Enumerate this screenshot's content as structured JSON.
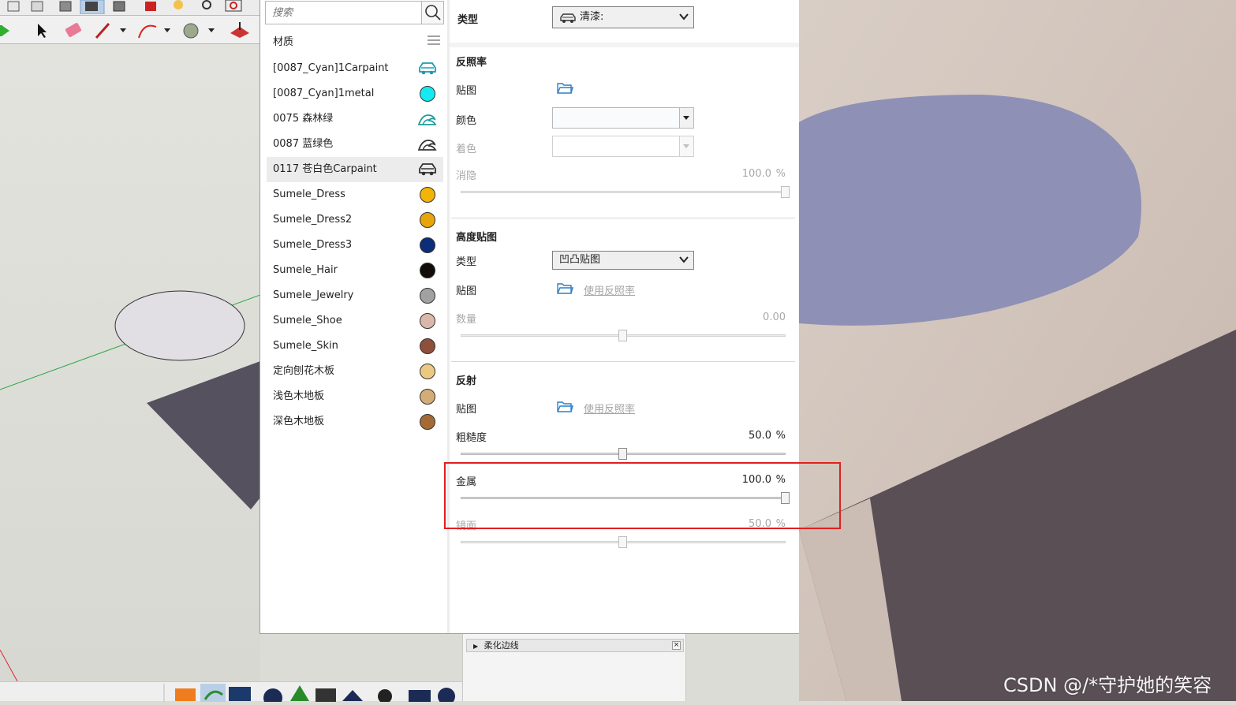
{
  "search": {
    "placeholder": "搜索"
  },
  "list_header": {
    "title": "材质"
  },
  "materials": [
    {
      "name": "[0087_Cyan]1Carpaint",
      "swatch": "car-icon",
      "color": "#1a9cb0"
    },
    {
      "name": "[0087_Cyan]1metal",
      "swatch": "circle",
      "color": "#15e9f2"
    },
    {
      "name": "0075 森林绿",
      "swatch": "wave-icon",
      "color": "#1a9c9c"
    },
    {
      "name": "0087 蓝绿色",
      "swatch": "wave-icon",
      "color": "#333333"
    },
    {
      "name": "0117 苍白色Carpaint",
      "swatch": "car-icon",
      "color": "#333333",
      "selected": true
    },
    {
      "name": "Sumele_Dress",
      "swatch": "circle",
      "color": "#f2b408"
    },
    {
      "name": "Sumele_Dress2",
      "swatch": "circle",
      "color": "#e8a40b"
    },
    {
      "name": "Sumele_Dress3",
      "swatch": "circle",
      "color": "#0b2d7a"
    },
    {
      "name": "Sumele_Hair",
      "swatch": "circle",
      "color": "#120c0a"
    },
    {
      "name": "Sumele_Jewelry",
      "swatch": "circle",
      "color": "#a1a1a1"
    },
    {
      "name": "Sumele_Shoe",
      "swatch": "circle",
      "color": "#d9b8aa"
    },
    {
      "name": "Sumele_Skin",
      "swatch": "circle",
      "color": "#8e4f3b"
    },
    {
      "name": "定向刨花木板",
      "swatch": "circle",
      "color": "#ecc983"
    },
    {
      "name": "浅色木地板",
      "swatch": "circle",
      "color": "#d3ac78"
    },
    {
      "name": "深色木地板",
      "swatch": "circle",
      "color": "#a46a34"
    }
  ],
  "props": {
    "type_label": "类型",
    "type_value": "清漆:",
    "albedo": {
      "header": "反照率",
      "map_label": "贴图",
      "color_label": "颜色",
      "tint_label": "着色",
      "opacity_label": "消隐",
      "opacity_value": "100.0",
      "opacity_unit": "%",
      "opacity_level": 1.0
    },
    "height": {
      "header": "高度贴图",
      "type_label": "类型",
      "type_value": "凹凸贴图",
      "map_label": "贴图",
      "map_link": "使用反照率",
      "amount_label": "数量",
      "amount_value": "0.00",
      "amount_level": 0.5
    },
    "reflection": {
      "header": "反射",
      "map_label": "贴图",
      "map_link": "使用反照率",
      "roughness_label": "粗糙度",
      "roughness_value": "50.0",
      "roughness_unit": "%",
      "roughness_level": 0.5,
      "metal_label": "金属",
      "metal_value": "100.0",
      "metal_unit": "%",
      "metal_level": 1.0,
      "specular_label": "镜面",
      "specular_value": "50.0",
      "specular_unit": "%",
      "specular_level": 0.5
    }
  },
  "tray": {
    "row_label": "柔化边线",
    "close_glyph": "×"
  },
  "watermark": "CSDN @/*守护她的笑容",
  "accent_colors": {
    "highlight": "#e02020",
    "folder": "#2d7fc9"
  }
}
